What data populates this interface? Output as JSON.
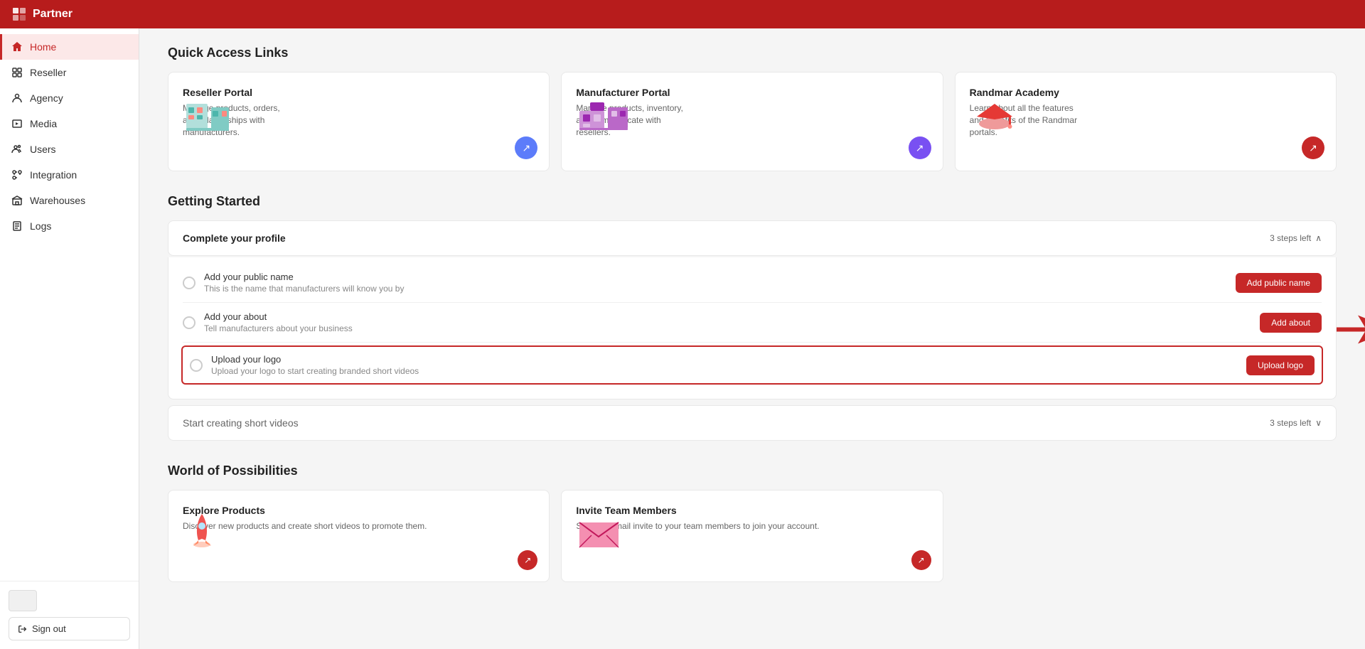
{
  "topbar": {
    "logo_text": "Partner",
    "logo_icon": "F"
  },
  "sidebar": {
    "items": [
      {
        "id": "home",
        "label": "Home",
        "active": true
      },
      {
        "id": "reseller",
        "label": "Reseller",
        "active": false
      },
      {
        "id": "agency",
        "label": "Agency",
        "active": false
      },
      {
        "id": "media",
        "label": "Media",
        "active": false
      },
      {
        "id": "users",
        "label": "Users",
        "active": false
      },
      {
        "id": "integration",
        "label": "Integration",
        "active": false
      },
      {
        "id": "warehouses",
        "label": "Warehouses",
        "active": false
      },
      {
        "id": "logs",
        "label": "Logs",
        "active": false
      }
    ],
    "signout_label": "Sign out"
  },
  "main": {
    "quick_access": {
      "title": "Quick Access Links",
      "cards": [
        {
          "id": "reseller-portal",
          "title": "Reseller Portal",
          "desc": "Manage products, orders, and relationships with manufacturers.",
          "btn_color": "blue"
        },
        {
          "id": "manufacturer-portal",
          "title": "Manufacturer Portal",
          "desc": "Manage products, inventory, and communicate with resellers.",
          "btn_color": "purple"
        },
        {
          "id": "randmar-academy",
          "title": "Randmar Academy",
          "desc": "Learn about all the features and benefits of the Randmar portals.",
          "btn_color": "red"
        }
      ]
    },
    "getting_started": {
      "title": "Getting Started",
      "complete_profile": {
        "header": "Complete your profile",
        "steps_left": "3 steps left",
        "items": [
          {
            "id": "public-name",
            "label": "Add your public name",
            "sublabel": "This is the name that manufacturers will know you by",
            "btn_label": "Add public name",
            "highlighted": false
          },
          {
            "id": "about",
            "label": "Add your about",
            "sublabel": "Tell manufacturers about your business",
            "btn_label": "Add about",
            "highlighted": false
          },
          {
            "id": "upload-logo",
            "label": "Upload your logo",
            "sublabel": "Upload your logo to start creating branded short videos",
            "btn_label": "Upload logo",
            "highlighted": true
          }
        ]
      },
      "start_creating": {
        "label": "Start creating short videos",
        "steps_left": "3 steps left"
      }
    },
    "world_of_possibilities": {
      "title": "World of Possibilities",
      "cards": [
        {
          "id": "explore-products",
          "title": "Explore Products",
          "desc": "Discover new products and create short videos to promote them."
        },
        {
          "id": "invite-team",
          "title": "Invite Team Members",
          "desc": "Send an email invite to your team members to join your account."
        }
      ]
    }
  }
}
